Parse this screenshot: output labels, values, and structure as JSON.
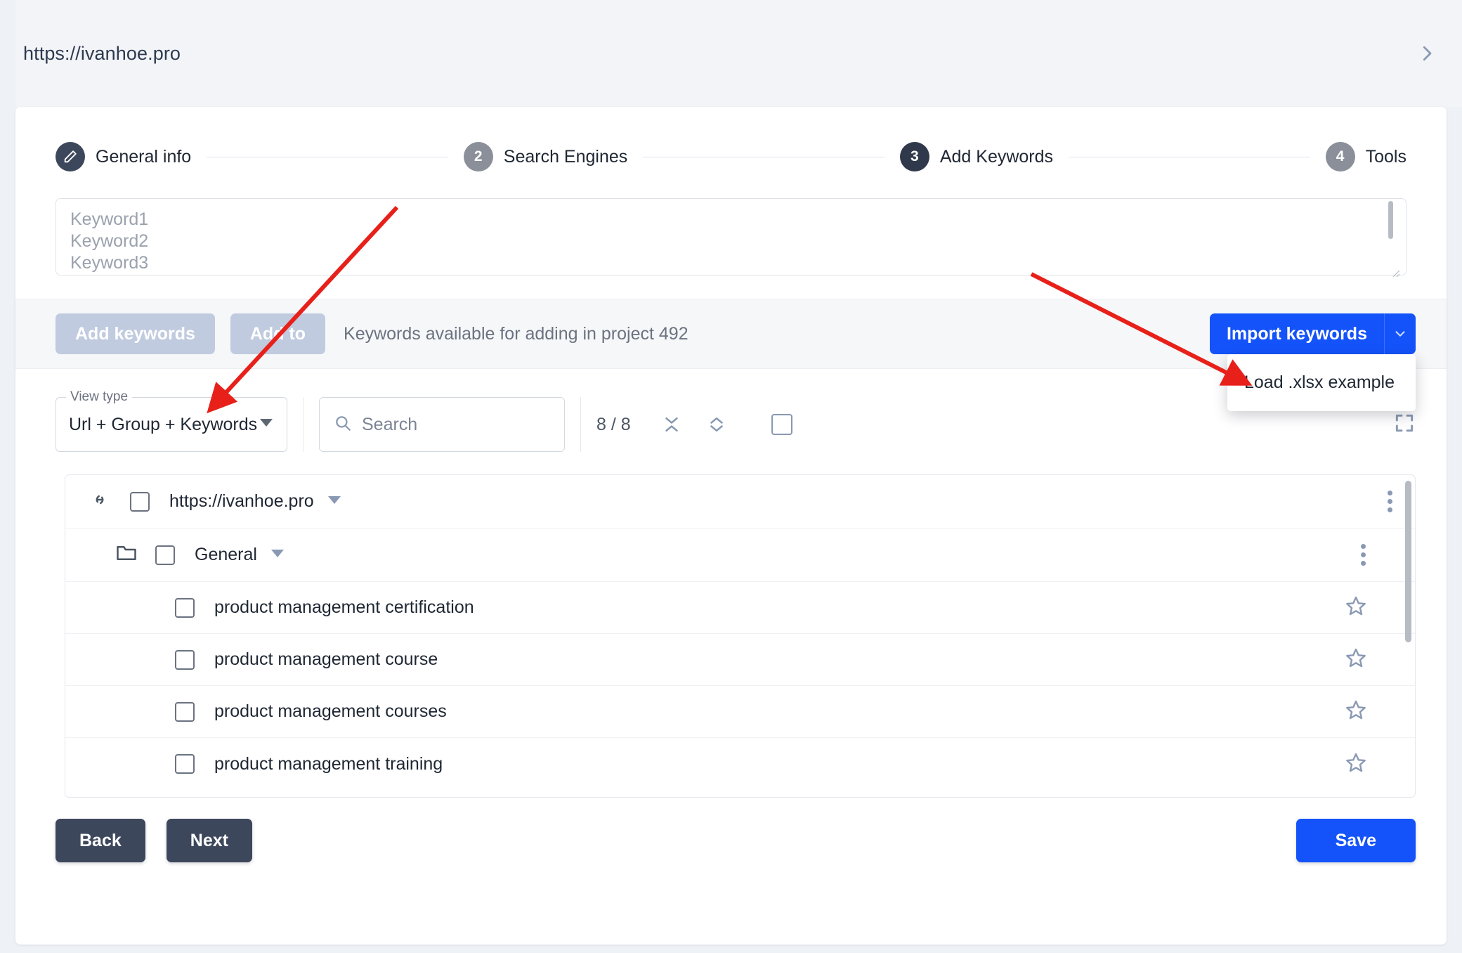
{
  "topbar": {
    "site_url": "https://ivanhoe.pro",
    "expand_icon": "chevron-right-icon"
  },
  "stepper": {
    "steps": [
      {
        "badge": "pencil-icon",
        "label": "General info",
        "state": "done"
      },
      {
        "badge": "2",
        "label": "Search Engines",
        "state": "inactive"
      },
      {
        "badge": "3",
        "label": "Add Keywords",
        "state": "active"
      },
      {
        "badge": "4",
        "label": "Tools",
        "state": "inactive"
      }
    ]
  },
  "keywords_input": {
    "value": "",
    "placeholder": "Keyword1\nKeyword2\nKeyword3"
  },
  "actionbar": {
    "add_keywords_label": "Add keywords",
    "add_to_label": "Add to",
    "availability_text": "Keywords available for adding in project 492",
    "import_label": "Import keywords",
    "import_caret_icon": "chevron-down-icon",
    "dropdown": {
      "items": [
        "Load .xlsx example"
      ]
    }
  },
  "filterbar": {
    "view_type_legend": "View type",
    "view_type_value": "Url + Group + Keywords",
    "search_placeholder": "Search",
    "search_value": "",
    "search_icon": "search-icon",
    "count": "8 / 8",
    "collapse_all_icon": "collapse-all-icon",
    "expand_all_icon": "expand-all-icon",
    "select_all_checkbox": "unchecked",
    "fullscreen_icon": "fullscreen-icon"
  },
  "tree": {
    "url_row": {
      "icon": "link-icon",
      "label": "https://ivanhoe.pro",
      "caret": "caret-down-icon",
      "checkbox": "unchecked",
      "menu": "kebab-menu-icon"
    },
    "group_row": {
      "icon": "folder-icon",
      "label": "General",
      "caret": "caret-down-icon",
      "checkbox": "unchecked",
      "menu": "kebab-menu-icon"
    },
    "keywords": [
      {
        "label": "product management certification",
        "checkbox": "unchecked",
        "star": "star-outline-icon"
      },
      {
        "label": "product management course",
        "checkbox": "unchecked",
        "star": "star-outline-icon"
      },
      {
        "label": "product management courses",
        "checkbox": "unchecked",
        "star": "star-outline-icon"
      },
      {
        "label": "product management training",
        "checkbox": "unchecked",
        "star": "star-outline-icon"
      }
    ]
  },
  "footer": {
    "back_label": "Back",
    "next_label": "Next",
    "save_label": "Save"
  },
  "colors": {
    "accent_blue": "#1453fa",
    "dark_slate": "#3d475c",
    "disabled_blue": "#c0cbdf",
    "page_bg": "#eef1f5",
    "annotation_red": "#e8201a"
  }
}
